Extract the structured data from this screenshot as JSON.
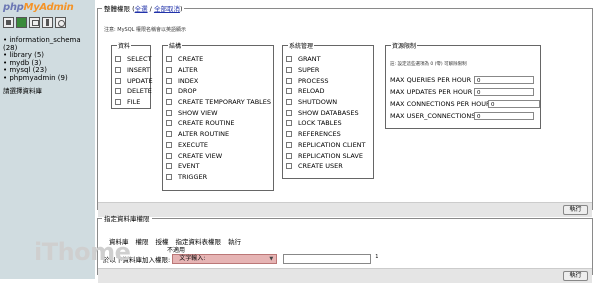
{
  "sidebar": {
    "logo_part1": "php",
    "logo_part2": "MyAdmin",
    "icons": [
      "home-icon",
      "exit-icon",
      "query-icon",
      "docs-icon",
      "refresh-icon"
    ],
    "databases": [
      {
        "label": "information_schema (28)"
      },
      {
        "label": "library (5)"
      },
      {
        "label": "mydb (3)"
      },
      {
        "label": "mysql (23)"
      },
      {
        "label": "phpmyadmin (9)"
      }
    ],
    "note": "請選擇資料庫"
  },
  "global_privileges": {
    "legend_prefix": "整體權限 (",
    "check_all": "全選",
    "sep": " / ",
    "uncheck_all": "全部取消",
    "legend_suffix": ")",
    "note": "注意: MySQL 權限名稱會以英語顯示",
    "data_group": {
      "title": "資料",
      "items": [
        "SELECT",
        "INSERT",
        "UPDATE",
        "DELETE",
        "FILE"
      ]
    },
    "structure_group": {
      "title": "結構",
      "items": [
        "CREATE",
        "ALTER",
        "INDEX",
        "DROP",
        "CREATE TEMPORARY TABLES",
        "SHOW VIEW",
        "CREATE ROUTINE",
        "ALTER ROUTINE",
        "EXECUTE",
        "CREATE VIEW",
        "EVENT",
        "TRIGGER"
      ]
    },
    "admin_group": {
      "title": "系統管理",
      "items": [
        "GRANT",
        "SUPER",
        "PROCESS",
        "RELOAD",
        "SHUTDOWN",
        "SHOW DATABASES",
        "LOCK TABLES",
        "REFERENCES",
        "REPLICATION CLIENT",
        "REPLICATION SLAVE",
        "CREATE USER"
      ]
    },
    "resource_limits": {
      "title": "資源限制",
      "note": "註: 設定這些選項為 0 (零) 可解除限制",
      "items": [
        {
          "label": "MAX QUERIES PER HOUR",
          "value": "0"
        },
        {
          "label": "MAX UPDATES PER HOUR",
          "value": "0"
        },
        {
          "label": "MAX CONNECTIONS PER HOUR",
          "value": "0"
        },
        {
          "label": "MAX USER_CONNECTIONS",
          "value": "0"
        }
      ]
    },
    "go_button": "執行"
  },
  "db_privileges": {
    "legend": "指定資料庫權限",
    "headers": [
      "資料庫",
      "權限",
      "授權",
      "指定資料表權限",
      "執行"
    ],
    "empty": "不適用",
    "add_label": "於以下資料庫加入權限:",
    "select_value": "文字輸入:",
    "footnote": "1",
    "go_button": "執行"
  },
  "watermark": "iThome"
}
